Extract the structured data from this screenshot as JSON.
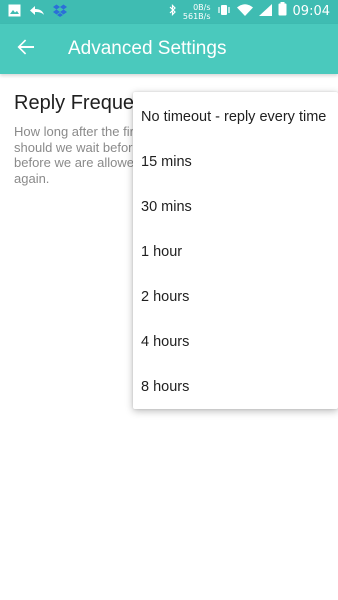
{
  "status_bar": {
    "upload_speed": "0B/s",
    "download_speed": "561B/s",
    "time": "09:04",
    "icons": [
      "image-icon",
      "reply-icon",
      "dropbox-icon",
      "bluetooth-icon",
      "vibrate-icon",
      "wifi-icon",
      "signal-icon",
      "battery-icon"
    ]
  },
  "app_bar": {
    "title": "Advanced Settings",
    "back_icon": "arrow-back-icon"
  },
  "preference": {
    "title": "Reply Frequency",
    "summary": "How long after the first auto reply to a message, should we wait before we send another auto reply before we are allowed to send, to that same person again."
  },
  "dropdown": {
    "options": [
      "No timeout - reply every time",
      "15 mins",
      "30 mins",
      "1 hour",
      "2 hours",
      "4 hours",
      "8 hours"
    ]
  },
  "colors": {
    "status_bar": "#3fbcb2",
    "app_bar": "#4ac9bd"
  }
}
